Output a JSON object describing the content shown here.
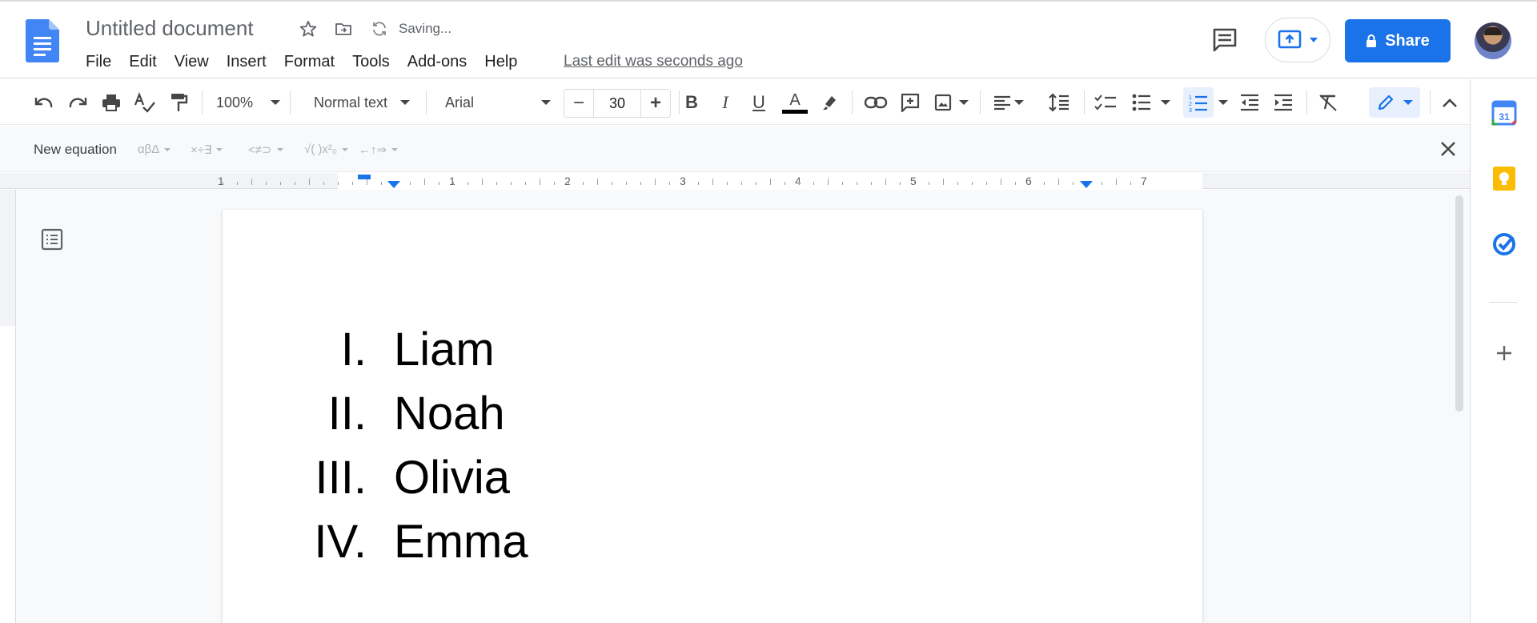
{
  "header": {
    "doc_title": "Untitled document",
    "saving_status": "Saving...",
    "last_edit": "Last edit was seconds ago",
    "share_label": "Share",
    "menu": [
      "File",
      "Edit",
      "View",
      "Insert",
      "Format",
      "Tools",
      "Add-ons",
      "Help"
    ]
  },
  "toolbar": {
    "zoom": "100%",
    "style": "Normal text",
    "font": "Arial",
    "font_size": "30",
    "minus": "−",
    "plus": "+",
    "bold": "B",
    "italic": "I",
    "underline": "U",
    "text_color": "A"
  },
  "equation_bar": {
    "new_equation": "New equation",
    "greek": "αβΔ",
    "operators": "×÷∃",
    "relations": "<≠⊃",
    "math": "√( )x²₀",
    "arrows": "←↑⇒"
  },
  "ruler": {
    "labels": [
      "1",
      "1",
      "2",
      "3",
      "4",
      "5",
      "6",
      "7"
    ]
  },
  "document": {
    "list": [
      {
        "num": "I.",
        "text": "Liam"
      },
      {
        "num": "II.",
        "text": "Noah"
      },
      {
        "num": "III.",
        "text": "Olivia"
      },
      {
        "num": "IV.",
        "text": "Emma"
      }
    ]
  },
  "side_panel": {
    "calendar_day": "31"
  },
  "colors": {
    "accent": "#1a73e8",
    "docs_blue": "#4285f4",
    "keep_yellow": "#fbbc04"
  }
}
